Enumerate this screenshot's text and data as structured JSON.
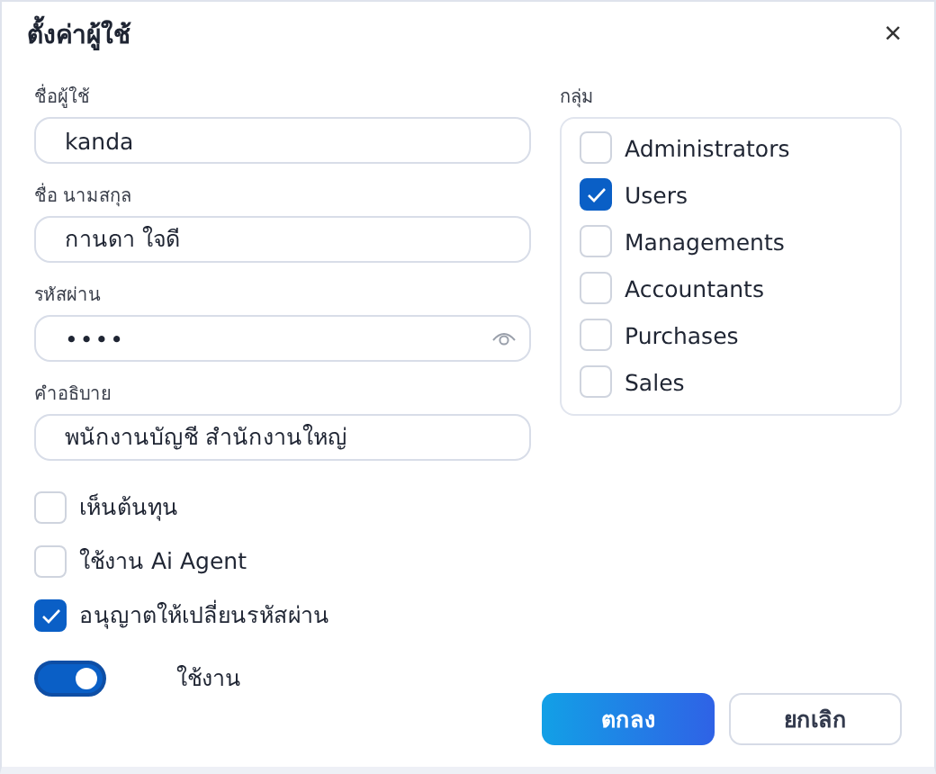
{
  "window": {
    "title": "ตั้งค่าผู้ใช้",
    "close": "×"
  },
  "fields": [
    {
      "label": "ชื่อผู้ใช้",
      "value": "kanda",
      "kind": "text"
    },
    {
      "label": "ชื่อ นามสกุล",
      "value": "กานดา ใจดี",
      "kind": "text"
    },
    {
      "label": "รหัสผ่าน",
      "value": "••••",
      "kind": "password"
    },
    {
      "label": "คำอธิบาย",
      "value": "พนักงานบัญชี สำนักงานใหญ่",
      "kind": "text"
    }
  ],
  "options": [
    {
      "label": "เห็นต้นทุน",
      "checked": false
    },
    {
      "label": "ใช้งาน Ai Agent",
      "checked": false
    },
    {
      "label": "อนุญาตให้เปลี่ยนรหัสผ่าน",
      "checked": true
    }
  ],
  "active_toggle": {
    "label": "ใช้งาน",
    "on": true
  },
  "groups": {
    "label": "กลุ่ม",
    "items": [
      {
        "label": "Administrators",
        "checked": false
      },
      {
        "label": "Users",
        "checked": true
      },
      {
        "label": "Managements",
        "checked": false
      },
      {
        "label": "Accountants",
        "checked": false
      },
      {
        "label": "Purchases",
        "checked": false
      },
      {
        "label": "Sales",
        "checked": false
      }
    ]
  },
  "buttons": [
    {
      "label": "ตกลง",
      "kind": "primary"
    },
    {
      "label": "ยกเลิก",
      "kind": "secondary"
    }
  ]
}
